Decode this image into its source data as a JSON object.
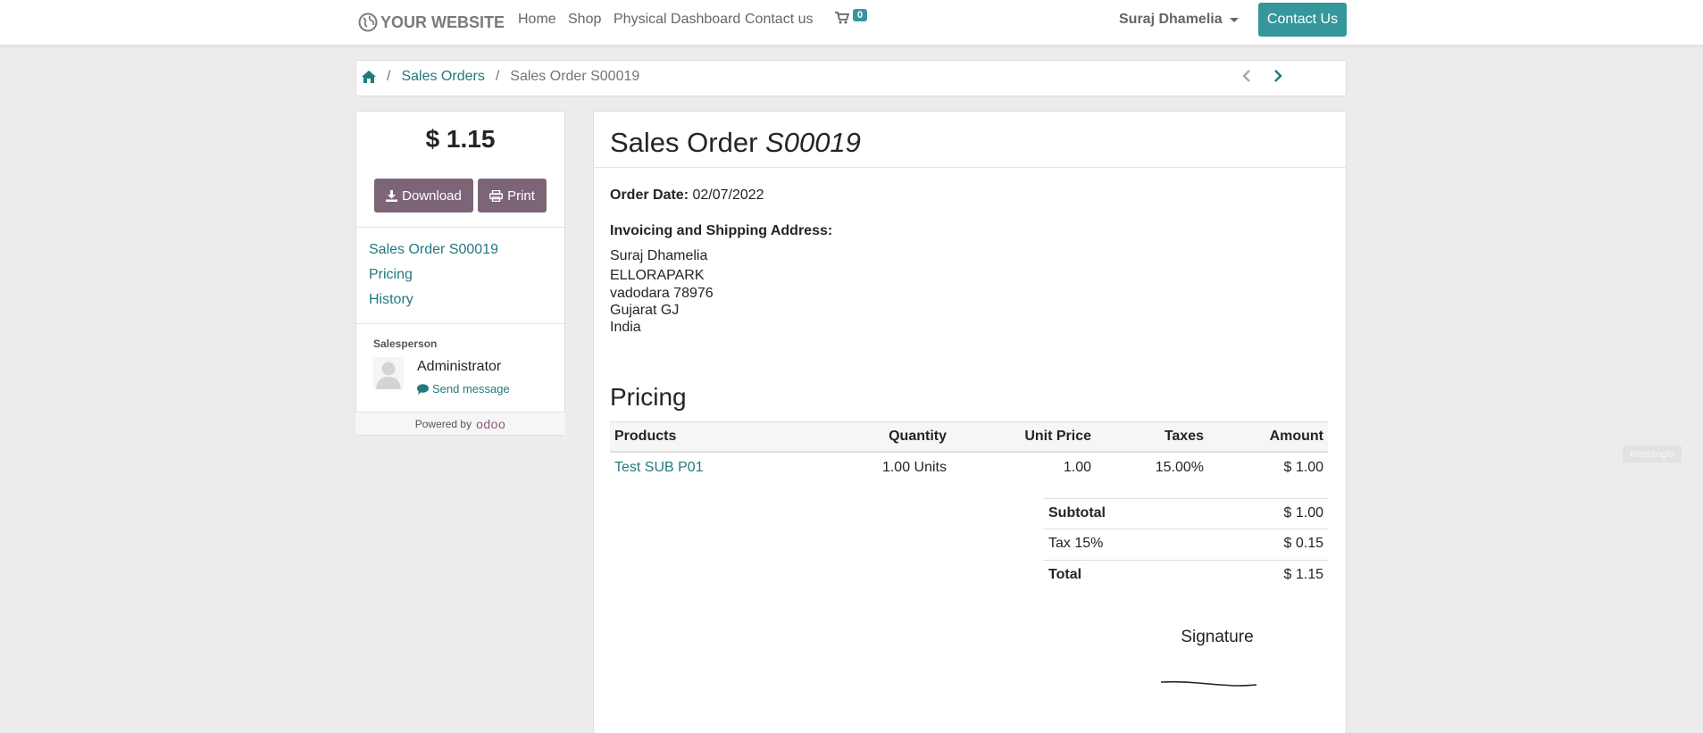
{
  "navbar": {
    "logo_text": "YOUR WEBSITE",
    "links": [
      "Home",
      "Shop",
      "Physical Dashboard",
      "Contact us"
    ],
    "cart_count": "0",
    "user_name": "Suraj Dhamelia",
    "contact_button": "Contact Us"
  },
  "breadcrumb": {
    "home_icon": "home-icon",
    "items": [
      "Sales Orders",
      "Sales Order S00019"
    ],
    "separator": "/"
  },
  "sidebar": {
    "amount": "$ 1.15",
    "download_label": "Download",
    "print_label": "Print",
    "nav_links": [
      "Sales Order S00019",
      "Pricing",
      "History"
    ],
    "salesperson_label": "Salesperson",
    "salesperson_name": "Administrator",
    "send_message_label": "Send message",
    "powered_by": "Powered by",
    "odoo_brand": "odoo"
  },
  "main": {
    "title_prefix": "Sales Order",
    "title_ref": "S00019",
    "order_date_label": "Order Date:",
    "order_date": "02/07/2022",
    "address_label": "Invoicing and Shipping Address:",
    "address_lines": [
      "Suraj Dhamelia",
      "ELLORAPARK",
      "vadodara 78976",
      "Gujarat GJ",
      "India"
    ],
    "pricing_heading": "Pricing",
    "table": {
      "headers": [
        "Products",
        "Quantity",
        "Unit Price",
        "Taxes",
        "Amount"
      ],
      "rows": [
        {
          "product": "Test SUB P01",
          "quantity": "1.00 Units",
          "unit_price": "1.00",
          "taxes": "15.00%",
          "amount": "$ 1.00"
        }
      ]
    },
    "totals": [
      {
        "label": "Subtotal",
        "value": "$ 1.00"
      },
      {
        "label": "Tax 15%",
        "value": "$ 0.15"
      },
      {
        "label": "Total",
        "value": "$ 1.15"
      }
    ],
    "signature_label": "Signature"
  },
  "overlay_tag": "Rectangle",
  "colors": {
    "accent": "#35979c",
    "link": "#217a7e",
    "button": "#7c6576",
    "background": "#ececec"
  }
}
